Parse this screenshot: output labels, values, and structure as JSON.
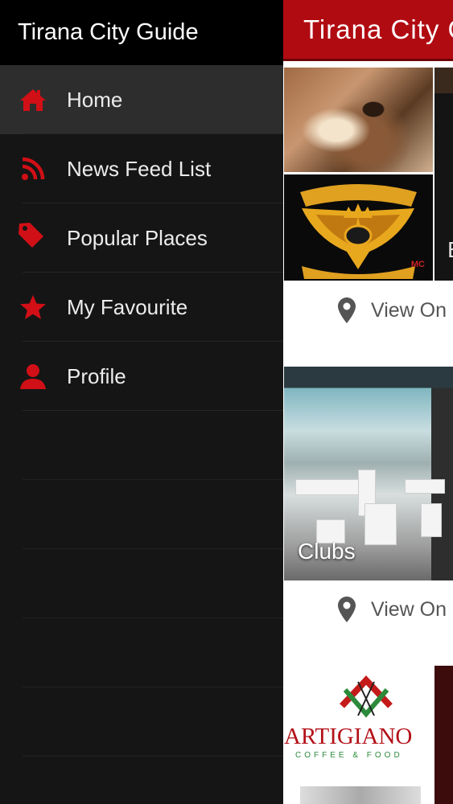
{
  "colors": {
    "accent": "#d10f16",
    "appbar": "#b10b12",
    "drawer_bg": "#151515",
    "header_bg": "#000000",
    "active_row": "#2d2d2d"
  },
  "drawer": {
    "title": "Tirana City Guide",
    "items": [
      {
        "label": "Home",
        "icon": "home-icon",
        "active": true
      },
      {
        "label": "News Feed List",
        "icon": "rss-icon",
        "active": false
      },
      {
        "label": "Popular Places",
        "icon": "tag-icon",
        "active": false
      },
      {
        "label": "My Favourite",
        "icon": "star-icon",
        "active": false
      },
      {
        "label": "Profile",
        "icon": "user-icon",
        "active": false
      }
    ]
  },
  "appbar": {
    "title": "Tirana City Guide",
    "menu_icon": "hamburger-icon"
  },
  "cards": [
    {
      "view_on_label": "View On Map",
      "letter": "E",
      "logo_text": "MC"
    },
    {
      "label": "Clubs",
      "view_on_label": "View On Map"
    },
    {
      "brand_name": "ARTIGIANO",
      "brand_sub": "COFFEE & FOOD"
    }
  ]
}
